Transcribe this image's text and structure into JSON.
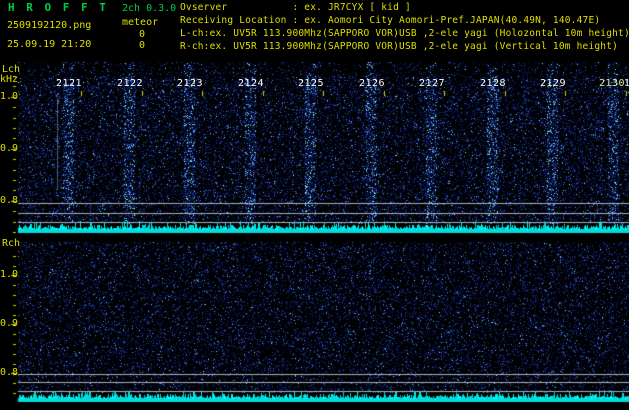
{
  "app": {
    "title": "H R O F F T",
    "version": "2ch 0.3.0",
    "filename": "2509192120.png",
    "datetime": "25.09.19 21:20",
    "mode": "meteor",
    "counts": [
      "0",
      "0"
    ]
  },
  "header": {
    "lines": [
      "Ovserver           : ex. JR7CYX [ kid ]",
      "Receiving Location : ex. Aomori City Aomori-Pref.JAPAN(40.49N, 140.47E)",
      "L-ch:ex. UV5R 113.900Mhz(SAPPORO VOR)USB ,2-ele yagi (Holozontal 10m height)",
      "R-ch:ex. UV5R 113.900Mhz(SAPPORO VOR)USB ,2-ele yagi (Vertical 10m height)"
    ]
  },
  "panels": {
    "lch": {
      "label": "Lch",
      "unit": "kHz",
      "freq": [
        "1.0",
        "0.9",
        "0.8"
      ]
    },
    "rch": {
      "label": "Rch",
      "freq": [
        "1.0",
        "0.9",
        "0.8"
      ]
    }
  },
  "timeline": {
    "labels": [
      "2121",
      "2122",
      "2123",
      "2124",
      "2125",
      "2126",
      "2127",
      "2128",
      "2129",
      "2130"
    ],
    "partial": "10"
  },
  "colors": {
    "title_green": "#00cc44",
    "text_yellow": "#dfdf00",
    "time_white": "#ffffff",
    "signal_cyan": "#00e0e0",
    "grid_gray": "#aab0b4",
    "spectrogram_blue": "#16308c",
    "background": "#000000"
  }
}
